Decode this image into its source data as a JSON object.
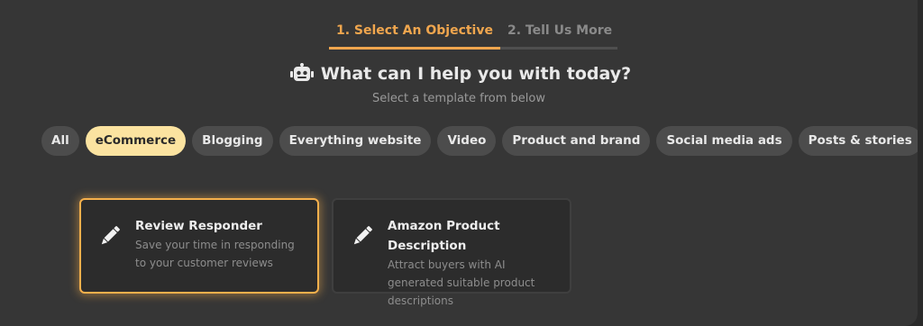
{
  "steps": [
    {
      "label": "1. Select An Objective"
    },
    {
      "label": "2. Tell Us More"
    }
  ],
  "header": {
    "title": "What can I help you with today?",
    "subtitle": "Select a template from below"
  },
  "filters": [
    "All",
    "eCommerce",
    "Blogging",
    "Everything website",
    "Video",
    "Product and brand",
    "Social media ads",
    "Posts & stories"
  ],
  "selected_filter": "eCommerce",
  "cards": [
    {
      "title": "Review Responder",
      "description": "Save your time in responding to your customer reviews",
      "icon": "pencil-icon"
    },
    {
      "title": "Amazon Product Description",
      "description": "Attract buyers with AI generated suitable product descriptions",
      "icon": "pencil-icon"
    }
  ],
  "colors": {
    "accent": "#f0a64e",
    "active_pill": "#fbe3a0",
    "background": "#363636"
  }
}
